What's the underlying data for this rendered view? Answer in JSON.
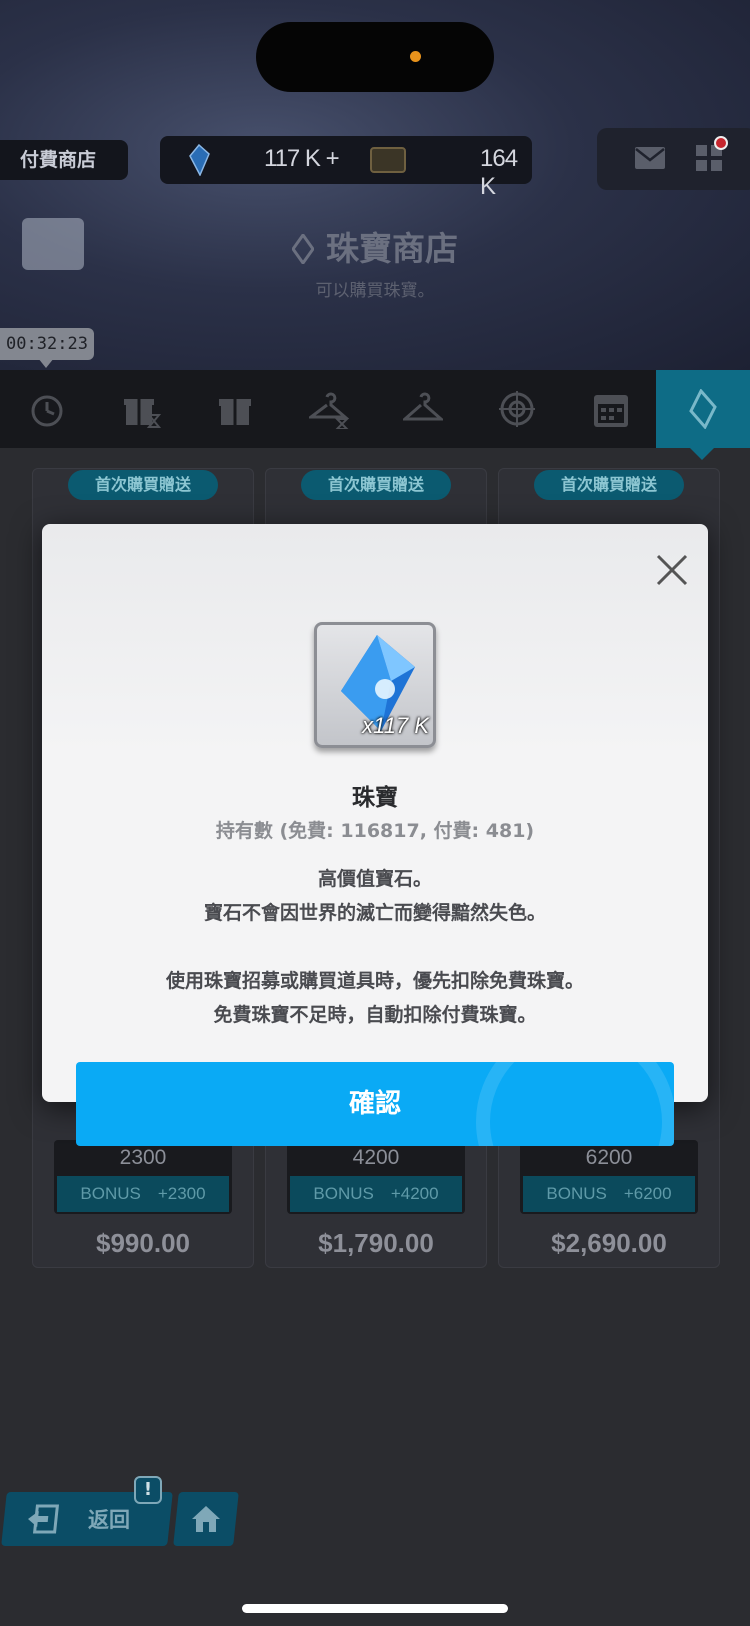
{
  "header": {
    "shop_tag": "付費商店",
    "gems": "117 K +",
    "tickets": "164 K",
    "title": "珠寶商店",
    "subtitle": "可以購買珠寶。",
    "timer": "00:32:23"
  },
  "tabs": [
    {
      "icon": "alarm-clock-icon"
    },
    {
      "icon": "gift-timer-icon"
    },
    {
      "icon": "gift-icon"
    },
    {
      "icon": "hanger-timer-icon"
    },
    {
      "icon": "hanger-icon"
    },
    {
      "icon": "target-icon"
    },
    {
      "icon": "calendar-icon"
    },
    {
      "icon": "gem-diamond-icon",
      "active": true
    }
  ],
  "cards": [
    {
      "badge": "首次購買贈送",
      "qty": "2300",
      "bonus": "BONUS　+2300",
      "price": "$990.00"
    },
    {
      "badge": "首次購買贈送",
      "qty": "4200",
      "bonus": "BONUS　+4200",
      "price": "$1,790.00"
    },
    {
      "badge": "首次購買贈送",
      "qty": "6200",
      "bonus": "BONUS　+6200",
      "price": "$2,690.00"
    }
  ],
  "modal": {
    "item_count": "x117 K",
    "item_name": "珠寶",
    "owned": "持有數 (免費: 116817, 付費: 481)",
    "desc_line1": "高價值寶石。",
    "desc_line2": "寶石不會因世界的滅亡而變得黯然失色。",
    "desc_line3": "使用珠寶招募或購買道具時，優先扣除免費珠寶。",
    "desc_line4": "免費珠寶不足時，自動扣除付費珠寶。",
    "confirm_label": "確認"
  },
  "bottom_nav": {
    "back_label": "返回",
    "alert": "!"
  },
  "colors": {
    "accent": "#0aaaf5",
    "tab_active": "#0e6c86"
  }
}
